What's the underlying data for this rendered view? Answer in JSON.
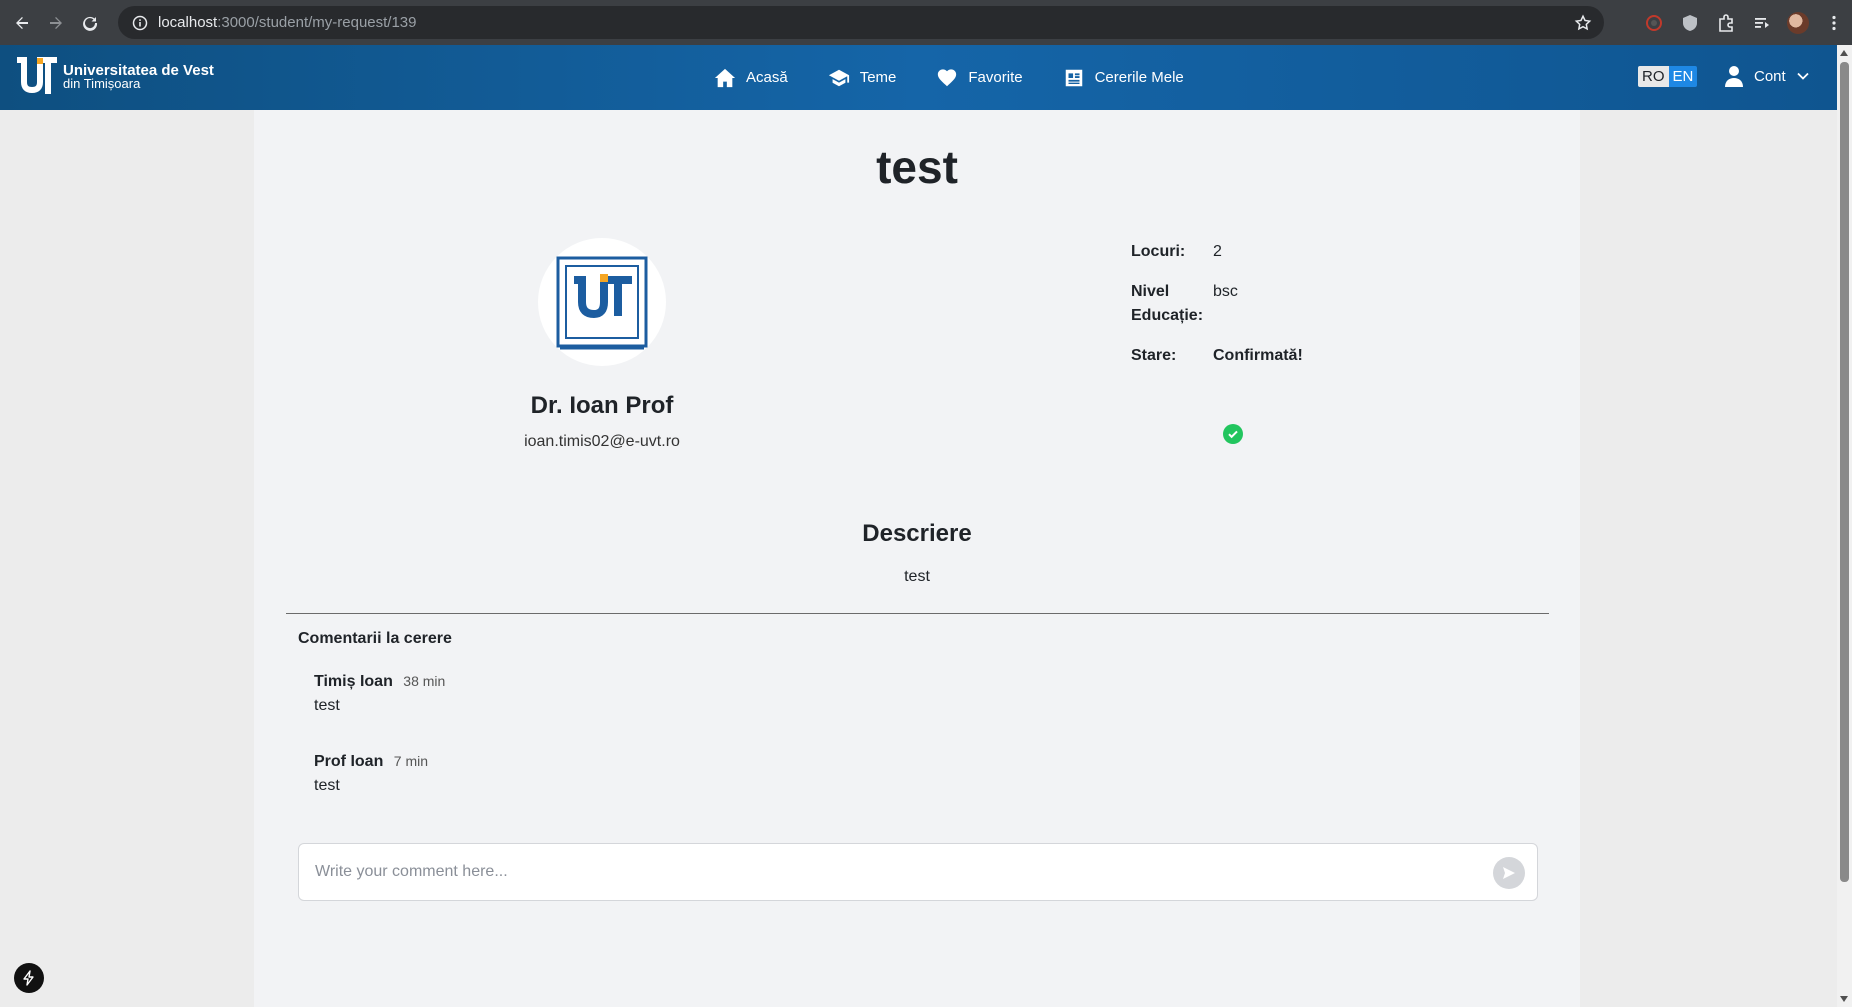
{
  "browser": {
    "url_host": "localhost",
    "url_path": ":3000/student/my-request/139"
  },
  "header": {
    "logo_line1": "Universitatea de Vest",
    "logo_line2": "din Timișoara",
    "nav": [
      {
        "label": "Acasă",
        "icon": "home-icon"
      },
      {
        "label": "Teme",
        "icon": "graduation-cap-icon"
      },
      {
        "label": "Favorite",
        "icon": "heart-icon"
      },
      {
        "label": "Cererile Mele",
        "icon": "document-list-icon"
      }
    ],
    "lang_ro": "RO",
    "lang_en": "EN",
    "account_label": "Cont"
  },
  "request": {
    "title": "test",
    "professor_name": "Dr. Ioan Prof",
    "professor_email": "ioan.timis02@e-uvt.ro",
    "details": [
      {
        "label": "Locuri:",
        "value": "2"
      },
      {
        "label": "Nivel Educație:",
        "value": "bsc"
      },
      {
        "label": "Stare:",
        "value": "Confirmată!"
      }
    ],
    "status_color": "#22c55e",
    "description_title": "Descriere",
    "description": "test"
  },
  "comments": {
    "title": "Comentarii la cerere",
    "items": [
      {
        "author": "Timiș Ioan",
        "time": "38 min",
        "text": "test"
      },
      {
        "author": "Prof Ioan",
        "time": "7 min",
        "text": "test"
      }
    ],
    "input_placeholder": "Write your comment here..."
  },
  "colors": {
    "header_blue": "#1565a8",
    "lang_active": "#1e88e5"
  }
}
